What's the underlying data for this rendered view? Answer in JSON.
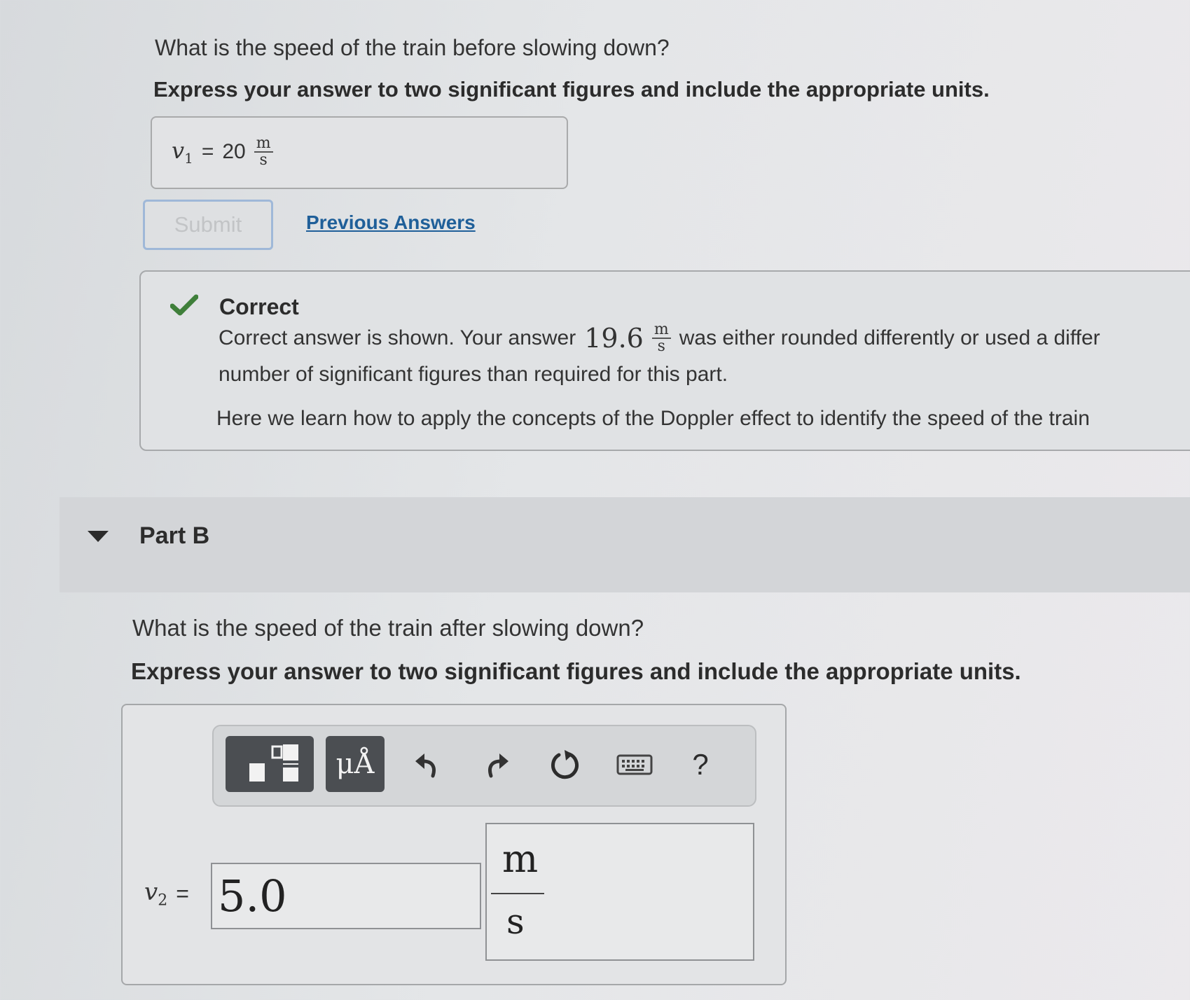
{
  "part_a": {
    "question": "What is the speed of the train before slowing down?",
    "instruction": "Express your answer to two significant figures and include the appropriate units.",
    "answer_var": "v",
    "answer_sub": "1",
    "answer_equals": "=",
    "answer_value": "20",
    "unit_num": "m",
    "unit_den": "s",
    "submit_label": "Submit",
    "previous_answers_label": "Previous Answers"
  },
  "feedback": {
    "status": "Correct",
    "line1_prefix": "Correct answer is shown. Your answer",
    "your_answer_value": "19.6",
    "your_answer_unit_num": "m",
    "your_answer_unit_den": "s",
    "line1_suffix": "was either rounded differently or used a differ",
    "line2": "number of significant figures than required for this part.",
    "line3": "Here we learn how to apply the concepts of the Doppler effect to identify the speed of the train"
  },
  "part_b": {
    "title": "Part B",
    "question": "What is the speed of the train after slowing down?",
    "instruction": "Express your answer to two significant figures and include the appropriate units.",
    "answer_var": "v",
    "answer_sub": "2",
    "answer_equals": "=",
    "value_input": "5.0",
    "unit_num": "m",
    "unit_den": "s",
    "toolbar": {
      "units_symbol_label": "μÅ",
      "help_label": "?"
    }
  }
}
